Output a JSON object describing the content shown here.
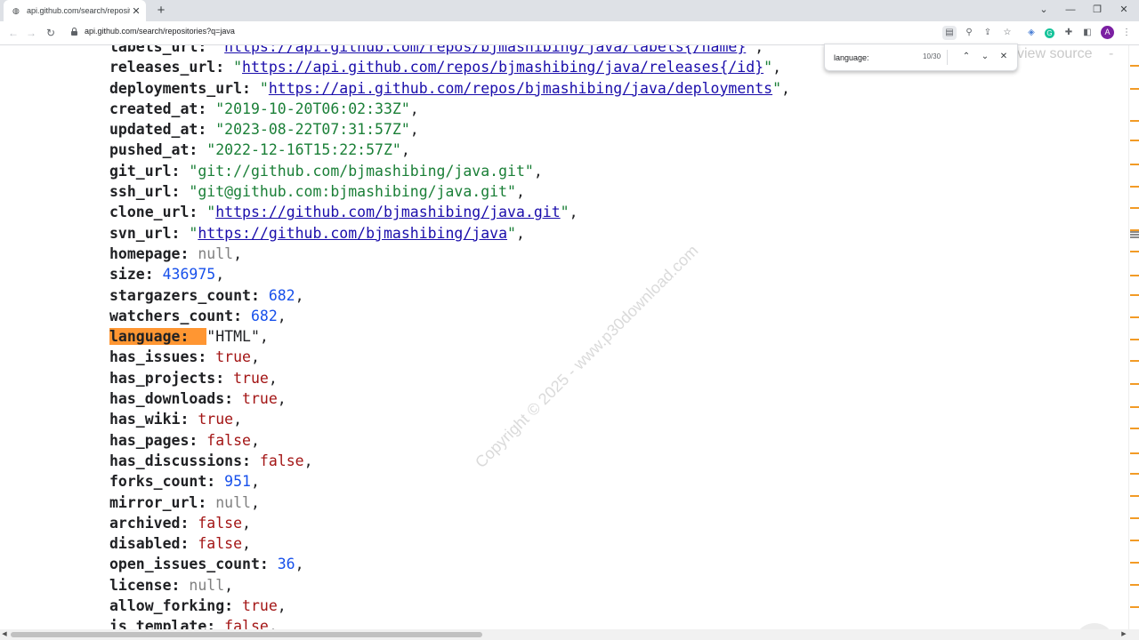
{
  "tab": {
    "title": "api.github.com/search/repositories",
    "close": "✕"
  },
  "newtab": "+",
  "window_controls": {
    "dropdown": "⌄",
    "minimize": "—",
    "restore": "❐",
    "close": "✕"
  },
  "nav": {
    "back": "←",
    "forward": "→",
    "reload": "↻"
  },
  "address": {
    "url": "api.github.com/search/repositories?q=java"
  },
  "avatar_letter": "A",
  "find": {
    "query": "language:",
    "count": "10/30",
    "prev": "⌃",
    "next": "⌄",
    "close": "✕"
  },
  "view_source": {
    "text": "view source",
    "dash": "-"
  },
  "watermark": "Copyright © 2025 - www.p30download.com",
  "json_lines": [
    {
      "key": "labels_url",
      "type": "link",
      "value": "https://api.github.com/repos/bjmashibing/java/labels{/name}"
    },
    {
      "key": "releases_url",
      "type": "link",
      "value": "https://api.github.com/repos/bjmashibing/java/releases{/id}"
    },
    {
      "key": "deployments_url",
      "type": "link",
      "value": "https://api.github.com/repos/bjmashibing/java/deployments"
    },
    {
      "key": "created_at",
      "type": "string",
      "value": "2019-10-20T06:02:33Z"
    },
    {
      "key": "updated_at",
      "type": "string",
      "value": "2023-08-22T07:31:57Z"
    },
    {
      "key": "pushed_at",
      "type": "string",
      "value": "2022-12-16T15:22:57Z"
    },
    {
      "key": "git_url",
      "type": "string",
      "value": "git://github.com/bjmashibing/java.git"
    },
    {
      "key": "ssh_url",
      "type": "string",
      "value": "git@github.com:bjmashibing/java.git"
    },
    {
      "key": "clone_url",
      "type": "link",
      "value": "https://github.com/bjmashibing/java.git"
    },
    {
      "key": "svn_url",
      "type": "link",
      "value": "https://github.com/bjmashibing/java"
    },
    {
      "key": "homepage",
      "type": "null",
      "value": "null"
    },
    {
      "key": "size",
      "type": "number",
      "value": "436975"
    },
    {
      "key": "stargazers_count",
      "type": "number",
      "value": "682"
    },
    {
      "key": "watchers_count",
      "type": "number",
      "value": "682"
    },
    {
      "key": "language",
      "type": "string",
      "value": "HTML",
      "highlight": true
    },
    {
      "key": "has_issues",
      "type": "bool",
      "value": "true"
    },
    {
      "key": "has_projects",
      "type": "bool",
      "value": "true"
    },
    {
      "key": "has_downloads",
      "type": "bool",
      "value": "true"
    },
    {
      "key": "has_wiki",
      "type": "bool",
      "value": "true"
    },
    {
      "key": "has_pages",
      "type": "bool",
      "value": "false"
    },
    {
      "key": "has_discussions",
      "type": "bool",
      "value": "false"
    },
    {
      "key": "forks_count",
      "type": "number",
      "value": "951"
    },
    {
      "key": "mirror_url",
      "type": "null",
      "value": "null"
    },
    {
      "key": "archived",
      "type": "bool",
      "value": "false"
    },
    {
      "key": "disabled",
      "type": "bool",
      "value": "false"
    },
    {
      "key": "open_issues_count",
      "type": "number",
      "value": "36"
    },
    {
      "key": "license",
      "type": "null",
      "value": "null"
    },
    {
      "key": "allow_forking",
      "type": "bool",
      "value": "true"
    },
    {
      "key": "is_template",
      "type": "bool",
      "value": "false"
    }
  ],
  "colors": {
    "highlight": "#ff9632",
    "string": "#1a7f37",
    "link": "#1a0dab",
    "number": "#1750eb",
    "bool": "#a31515",
    "null": "#808080"
  }
}
